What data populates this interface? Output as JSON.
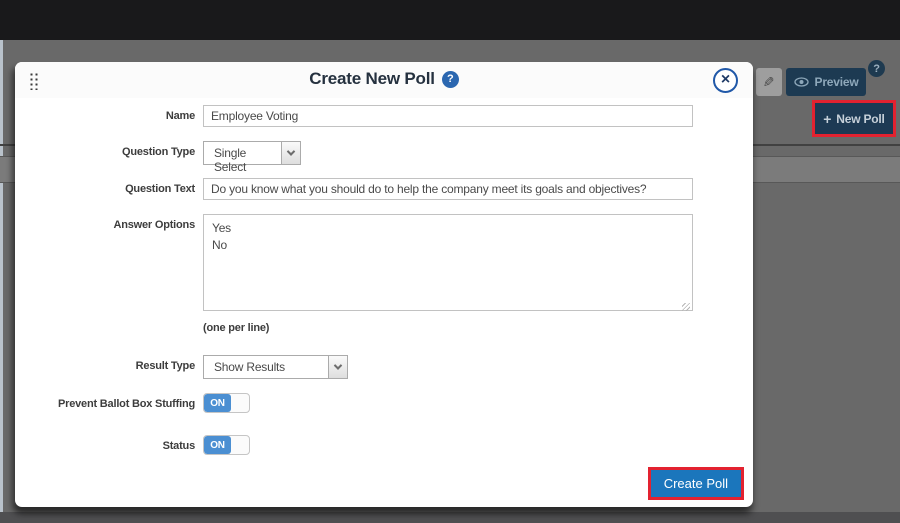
{
  "background": {
    "pencil_glyph": "✎",
    "preview": {
      "label": "Preview"
    },
    "help_glyph": "?",
    "new_poll": {
      "plus": "+",
      "label": "New Poll"
    }
  },
  "modal": {
    "title": "Create New Poll",
    "help_glyph": "?",
    "close_glyph": "×",
    "fields": {
      "name": {
        "label": "Name",
        "value": "Employee Voting"
      },
      "question_type": {
        "label": "Question Type",
        "value": "Single Select"
      },
      "question_text": {
        "label": "Question Text",
        "value": "Do you know what you should do to help the company meet its goals and objectives?"
      },
      "answer_options": {
        "label": "Answer Options",
        "value": "Yes\nNo",
        "hint": "(one per line)"
      },
      "result_type": {
        "label": "Result Type",
        "value": "Show Results"
      },
      "prevent_ballot_box_stuffing": {
        "label": "Prevent Ballot Box Stuffing",
        "state": "ON"
      },
      "status": {
        "label": "Status",
        "state": "ON"
      }
    },
    "create_button": "Create Poll"
  },
  "colors": {
    "accent_blue": "#1b76bc",
    "toggle_blue": "#4b8fd2",
    "navy": "#1d3a52",
    "annotation_red": "#e32230",
    "backdrop": "#696969"
  }
}
